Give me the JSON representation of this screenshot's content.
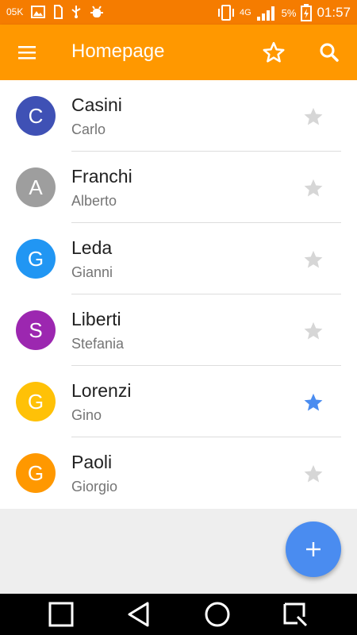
{
  "status_bar": {
    "data_speed": "05K",
    "network": "4G",
    "battery": "5%",
    "time": "01:57"
  },
  "app_bar": {
    "title": "Homepage",
    "menu_icon": "menu-icon",
    "star_icon": "star-outline-icon",
    "search_icon": "search-icon"
  },
  "contacts": [
    {
      "initial": "C",
      "surname": "Casini",
      "first_name": "Carlo",
      "color": "#3F51B5",
      "favorite": false
    },
    {
      "initial": "A",
      "surname": "Franchi",
      "first_name": "Alberto",
      "color": "#9E9E9E",
      "favorite": false
    },
    {
      "initial": "G",
      "surname": "Leda",
      "first_name": "Gianni",
      "color": "#2196F3",
      "favorite": false
    },
    {
      "initial": "S",
      "surname": "Liberti",
      "first_name": "Stefania",
      "color": "#9C27B0",
      "favorite": false
    },
    {
      "initial": "G",
      "surname": "Lorenzi",
      "first_name": "Gino",
      "color": "#FFC107",
      "favorite": true
    },
    {
      "initial": "G",
      "surname": "Paoli",
      "first_name": "Giorgio",
      "color": "#FF9800",
      "favorite": false
    }
  ],
  "colors": {
    "status_bar": "#F57C00",
    "app_bar": "#FF9800",
    "fab": "#4A8CF0",
    "star_active": "#4A8CF0",
    "star_inactive": "#D6D6D6"
  },
  "fab": {
    "icon": "plus-icon"
  },
  "nav_bar": {
    "buttons": [
      "recents-icon",
      "back-icon",
      "home-icon",
      "assist-icon"
    ]
  }
}
